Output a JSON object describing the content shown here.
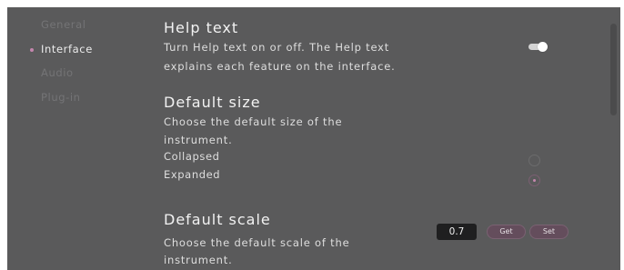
{
  "sidebar": {
    "items": [
      {
        "label": "General",
        "active": false
      },
      {
        "label": "Interface",
        "active": true
      },
      {
        "label": "Audio",
        "active": false
      },
      {
        "label": "Plug-in",
        "active": false
      }
    ],
    "active_indicator_color": "#c486ad"
  },
  "help_text": {
    "title": "Help text",
    "description_line1": "Turn Help text on or off. The Help text",
    "description_line2": "explains each feature on the interface.",
    "toggle_on": true
  },
  "default_size": {
    "title": "Default size",
    "description_line1": "Choose the default size of the",
    "description_line2": "instrument.",
    "options": [
      {
        "label": "Collapsed",
        "selected": false
      },
      {
        "label": "Expanded",
        "selected": true
      }
    ]
  },
  "default_scale": {
    "title": "Default scale",
    "description_line1": "Choose the default scale of the",
    "description_line2": "instrument.",
    "value": "0.7",
    "get_label": "Get",
    "set_label": "Set"
  },
  "colors": {
    "panel_background": "#5a5a5b",
    "accent": "#c486ad",
    "button_background": "#644d5c"
  }
}
